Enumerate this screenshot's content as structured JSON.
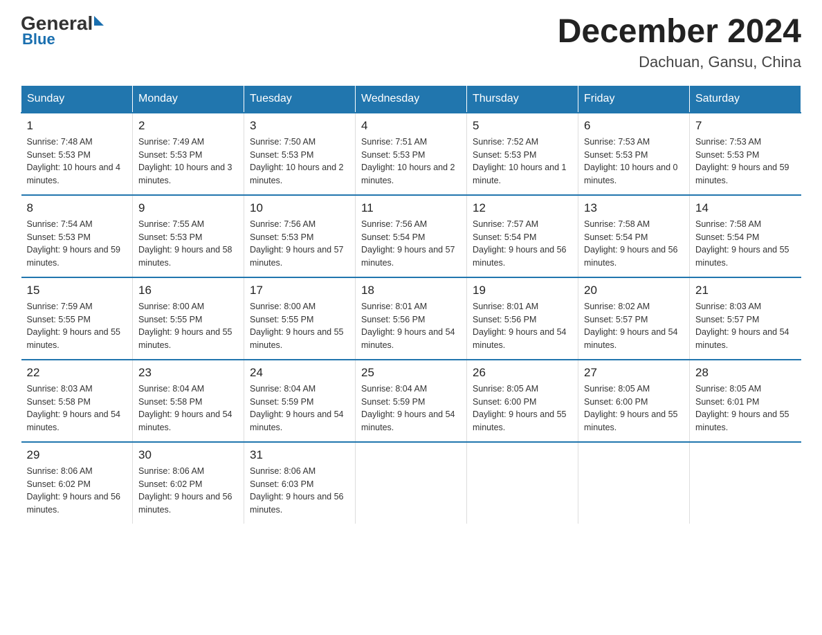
{
  "header": {
    "logo_general": "General",
    "logo_blue": "Blue",
    "title": "December 2024",
    "location": "Dachuan, Gansu, China"
  },
  "weekdays": [
    "Sunday",
    "Monday",
    "Tuesday",
    "Wednesday",
    "Thursday",
    "Friday",
    "Saturday"
  ],
  "weeks": [
    [
      {
        "day": "1",
        "sunrise": "7:48 AM",
        "sunset": "5:53 PM",
        "daylight": "10 hours and 4 minutes."
      },
      {
        "day": "2",
        "sunrise": "7:49 AM",
        "sunset": "5:53 PM",
        "daylight": "10 hours and 3 minutes."
      },
      {
        "day": "3",
        "sunrise": "7:50 AM",
        "sunset": "5:53 PM",
        "daylight": "10 hours and 2 minutes."
      },
      {
        "day": "4",
        "sunrise": "7:51 AM",
        "sunset": "5:53 PM",
        "daylight": "10 hours and 2 minutes."
      },
      {
        "day": "5",
        "sunrise": "7:52 AM",
        "sunset": "5:53 PM",
        "daylight": "10 hours and 1 minute."
      },
      {
        "day": "6",
        "sunrise": "7:53 AM",
        "sunset": "5:53 PM",
        "daylight": "10 hours and 0 minutes."
      },
      {
        "day": "7",
        "sunrise": "7:53 AM",
        "sunset": "5:53 PM",
        "daylight": "9 hours and 59 minutes."
      }
    ],
    [
      {
        "day": "8",
        "sunrise": "7:54 AM",
        "sunset": "5:53 PM",
        "daylight": "9 hours and 59 minutes."
      },
      {
        "day": "9",
        "sunrise": "7:55 AM",
        "sunset": "5:53 PM",
        "daylight": "9 hours and 58 minutes."
      },
      {
        "day": "10",
        "sunrise": "7:56 AM",
        "sunset": "5:53 PM",
        "daylight": "9 hours and 57 minutes."
      },
      {
        "day": "11",
        "sunrise": "7:56 AM",
        "sunset": "5:54 PM",
        "daylight": "9 hours and 57 minutes."
      },
      {
        "day": "12",
        "sunrise": "7:57 AM",
        "sunset": "5:54 PM",
        "daylight": "9 hours and 56 minutes."
      },
      {
        "day": "13",
        "sunrise": "7:58 AM",
        "sunset": "5:54 PM",
        "daylight": "9 hours and 56 minutes."
      },
      {
        "day": "14",
        "sunrise": "7:58 AM",
        "sunset": "5:54 PM",
        "daylight": "9 hours and 55 minutes."
      }
    ],
    [
      {
        "day": "15",
        "sunrise": "7:59 AM",
        "sunset": "5:55 PM",
        "daylight": "9 hours and 55 minutes."
      },
      {
        "day": "16",
        "sunrise": "8:00 AM",
        "sunset": "5:55 PM",
        "daylight": "9 hours and 55 minutes."
      },
      {
        "day": "17",
        "sunrise": "8:00 AM",
        "sunset": "5:55 PM",
        "daylight": "9 hours and 55 minutes."
      },
      {
        "day": "18",
        "sunrise": "8:01 AM",
        "sunset": "5:56 PM",
        "daylight": "9 hours and 54 minutes."
      },
      {
        "day": "19",
        "sunrise": "8:01 AM",
        "sunset": "5:56 PM",
        "daylight": "9 hours and 54 minutes."
      },
      {
        "day": "20",
        "sunrise": "8:02 AM",
        "sunset": "5:57 PM",
        "daylight": "9 hours and 54 minutes."
      },
      {
        "day": "21",
        "sunrise": "8:03 AM",
        "sunset": "5:57 PM",
        "daylight": "9 hours and 54 minutes."
      }
    ],
    [
      {
        "day": "22",
        "sunrise": "8:03 AM",
        "sunset": "5:58 PM",
        "daylight": "9 hours and 54 minutes."
      },
      {
        "day": "23",
        "sunrise": "8:04 AM",
        "sunset": "5:58 PM",
        "daylight": "9 hours and 54 minutes."
      },
      {
        "day": "24",
        "sunrise": "8:04 AM",
        "sunset": "5:59 PM",
        "daylight": "9 hours and 54 minutes."
      },
      {
        "day": "25",
        "sunrise": "8:04 AM",
        "sunset": "5:59 PM",
        "daylight": "9 hours and 54 minutes."
      },
      {
        "day": "26",
        "sunrise": "8:05 AM",
        "sunset": "6:00 PM",
        "daylight": "9 hours and 55 minutes."
      },
      {
        "day": "27",
        "sunrise": "8:05 AM",
        "sunset": "6:00 PM",
        "daylight": "9 hours and 55 minutes."
      },
      {
        "day": "28",
        "sunrise": "8:05 AM",
        "sunset": "6:01 PM",
        "daylight": "9 hours and 55 minutes."
      }
    ],
    [
      {
        "day": "29",
        "sunrise": "8:06 AM",
        "sunset": "6:02 PM",
        "daylight": "9 hours and 56 minutes."
      },
      {
        "day": "30",
        "sunrise": "8:06 AM",
        "sunset": "6:02 PM",
        "daylight": "9 hours and 56 minutes."
      },
      {
        "day": "31",
        "sunrise": "8:06 AM",
        "sunset": "6:03 PM",
        "daylight": "9 hours and 56 minutes."
      },
      null,
      null,
      null,
      null
    ]
  ]
}
